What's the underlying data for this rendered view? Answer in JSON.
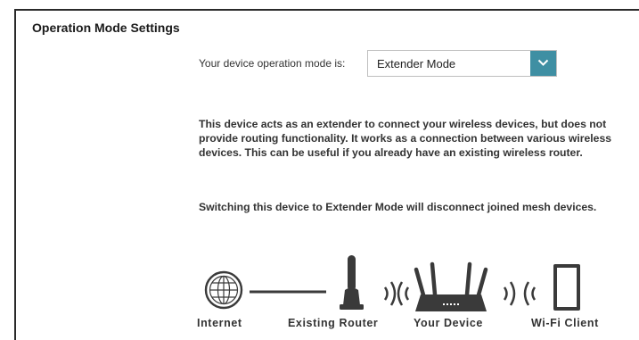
{
  "section": {
    "title": "Operation Mode Settings"
  },
  "mode": {
    "label": "Your device operation mode is:",
    "selected": "Extender Mode"
  },
  "description": {
    "p1": "This device acts as an extender to connect your wireless devices, but does not provide routing functionality. It works as a connection between various wireless devices. This can be useful if you already have an existing wireless router.",
    "p2": "Switching this device to Extender Mode will disconnect joined mesh devices."
  },
  "diagram": {
    "labels": {
      "internet": "Internet",
      "existing_router": "Existing Router",
      "your_device": "Your Device",
      "wifi_client": "Wi-Fi Client"
    },
    "icons": [
      "globe-icon",
      "router-icon",
      "wifi-waves-icon",
      "device-icon",
      "tablet-icon"
    ]
  },
  "colors": {
    "accent": "#3f8fa3",
    "icon": "#3a3a3a",
    "text": "#333333"
  }
}
